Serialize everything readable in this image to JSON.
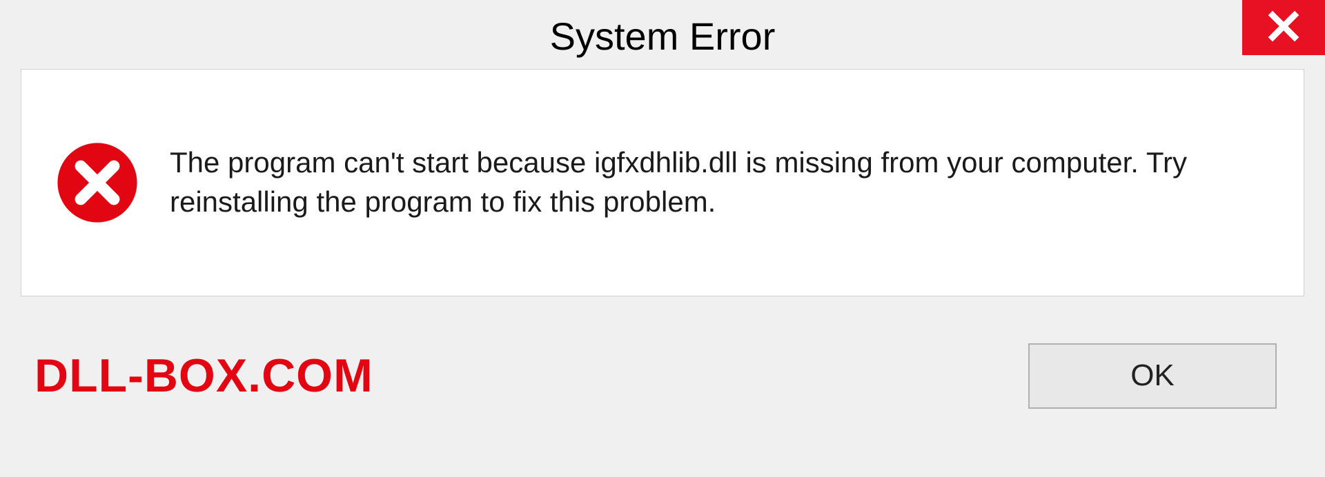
{
  "dialog": {
    "title": "System Error",
    "message": "The program can't start because igfxdhlib.dll is missing from your computer. Try reinstalling the program to fix this problem.",
    "ok_label": "OK"
  },
  "watermark": "DLL-BOX.COM",
  "colors": {
    "close_red": "#e81123",
    "error_red": "#e20613",
    "watermark_red": "#e20613"
  }
}
